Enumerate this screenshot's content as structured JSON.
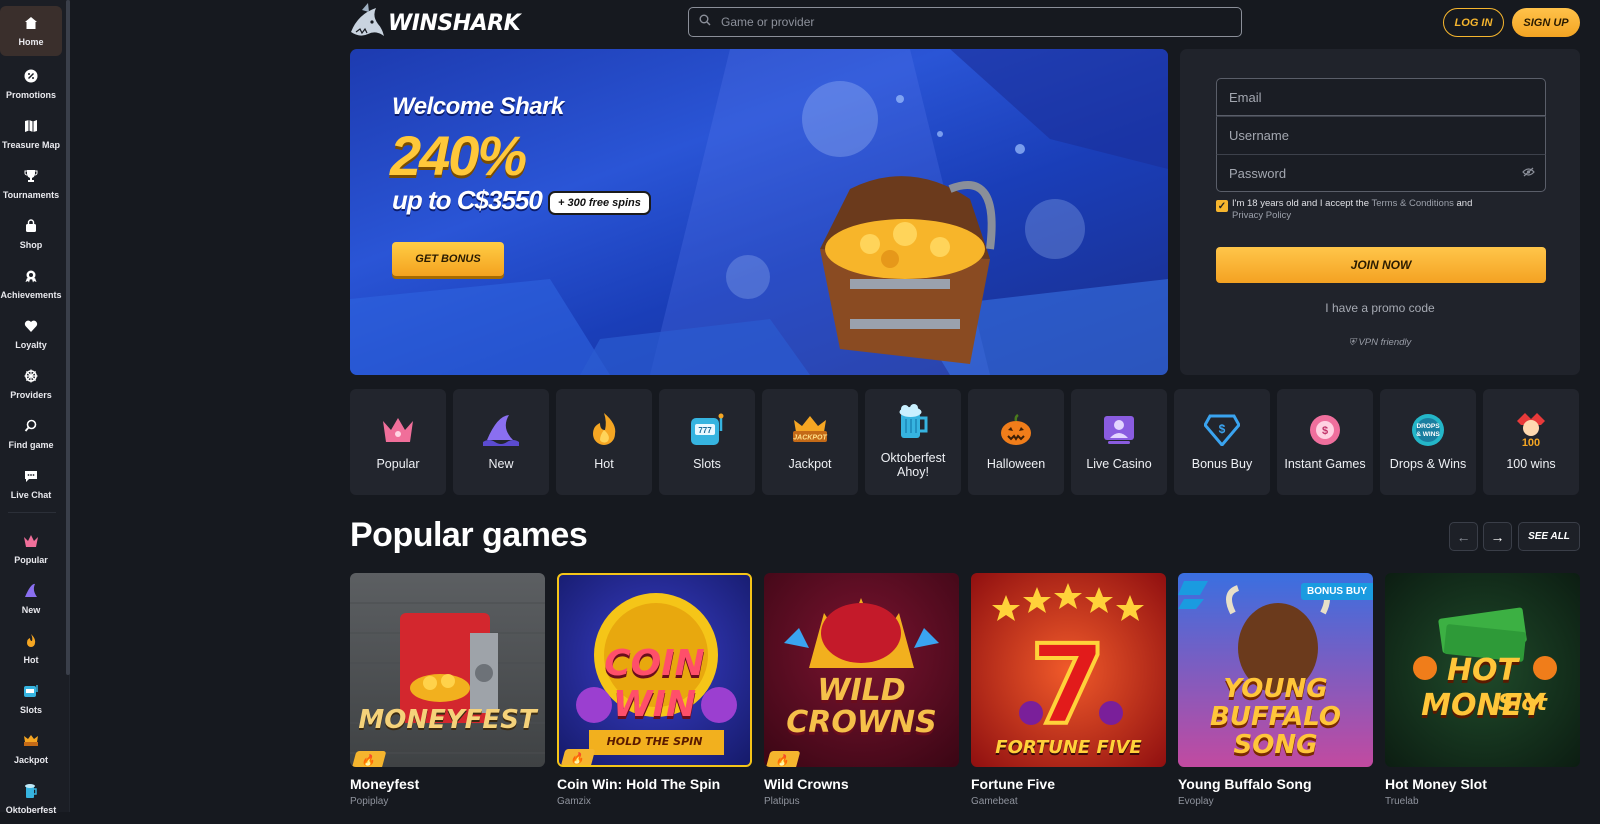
{
  "sidebar": {
    "items": [
      {
        "label": "Home",
        "icon": "home-icon"
      },
      {
        "label": "Promotions",
        "icon": "percent-icon"
      },
      {
        "label": "Treasure Map",
        "icon": "map-icon"
      },
      {
        "label": "Tournaments",
        "icon": "trophy-icon"
      },
      {
        "label": "Shop",
        "icon": "bag-icon"
      },
      {
        "label": "Achievements",
        "icon": "medal-icon"
      },
      {
        "label": "Loyalty",
        "icon": "heart-icon"
      },
      {
        "label": "Providers",
        "icon": "wheel-icon"
      },
      {
        "label": "Find game",
        "icon": "search-icon"
      },
      {
        "label": "Live Chat",
        "icon": "chat-icon"
      }
    ],
    "categories": [
      {
        "label": "Popular",
        "icon": "crown-icon"
      },
      {
        "label": "New",
        "icon": "shark-fin-icon"
      },
      {
        "label": "Hot",
        "icon": "fire-icon"
      },
      {
        "label": "Slots",
        "icon": "slot-machine-icon"
      },
      {
        "label": "Jackpot",
        "icon": "jackpot-icon"
      },
      {
        "label": "Oktoberfest",
        "icon": "beer-icon"
      }
    ]
  },
  "header": {
    "logo_text": "WINSHARK",
    "search_placeholder": "Game or provider",
    "login_label": "LOG IN",
    "signup_label": "SIGN UP"
  },
  "hero": {
    "line1": "Welcome Shark",
    "line2": "240%",
    "line3": "up to C$3550",
    "badge": "+ 300 free spins",
    "button": "GET BONUS"
  },
  "register": {
    "email_placeholder": "Email",
    "username_placeholder": "Username",
    "password_placeholder": "Password",
    "terms_pre": "I'm 18 years old and I accept the ",
    "terms_link": "Terms & Conditions",
    "terms_mid": " and",
    "privacy_link": "Privacy Policy",
    "join_label": "JOIN NOW",
    "promo_label": "I have a promo code",
    "vpn_label": "VPN friendly"
  },
  "categories": [
    {
      "label": "Popular",
      "icon": "crown-icon"
    },
    {
      "label": "New",
      "icon": "shark-fin-icon"
    },
    {
      "label": "Hot",
      "icon": "fire-icon"
    },
    {
      "label": "Slots",
      "icon": "slot-machine-icon"
    },
    {
      "label": "Jackpot",
      "icon": "jackpot-icon"
    },
    {
      "label": "Oktoberfest Ahoy!",
      "icon": "beer-mug-icon"
    },
    {
      "label": "Halloween",
      "icon": "pumpkin-icon"
    },
    {
      "label": "Live Casino",
      "icon": "live-dealer-icon"
    },
    {
      "label": "Bonus Buy",
      "icon": "diamond-dollar-icon"
    },
    {
      "label": "Instant Games",
      "icon": "instant-icon"
    },
    {
      "label": "Drops & Wins",
      "icon": "drops-wins-icon"
    },
    {
      "label": "100 wins",
      "icon": "jester-icon"
    }
  ],
  "popular": {
    "title": "Popular games",
    "see_all": "SEE ALL",
    "games": [
      {
        "name": "Moneyfest",
        "provider": "Popiplay",
        "art_title": "MONEYFEST",
        "hot": true
      },
      {
        "name": "Coin Win: Hold The Spin",
        "provider": "Gamzix",
        "art_title": "COIN WIN",
        "art_sub": "HOLD THE SPIN",
        "hot": true
      },
      {
        "name": "Wild Crowns",
        "provider": "Platipus",
        "art_title": "WILD CROWNS",
        "hot": true
      },
      {
        "name": "Fortune Five",
        "provider": "Gamebeat",
        "art_title": "FORTUNE FIVE"
      },
      {
        "name": "Young Buffalo Song",
        "provider": "Evoplay",
        "art_title": "YOUNG BUFFALO SONG",
        "badge": "BONUS BUY"
      },
      {
        "name": "Hot Money Slot",
        "provider": "Truelab",
        "art_title": "HOT MONEY",
        "art_sub": "Slot"
      }
    ]
  },
  "colors": {
    "accent": "#f5b52e",
    "background": "#16191f",
    "panel": "#20232b"
  }
}
